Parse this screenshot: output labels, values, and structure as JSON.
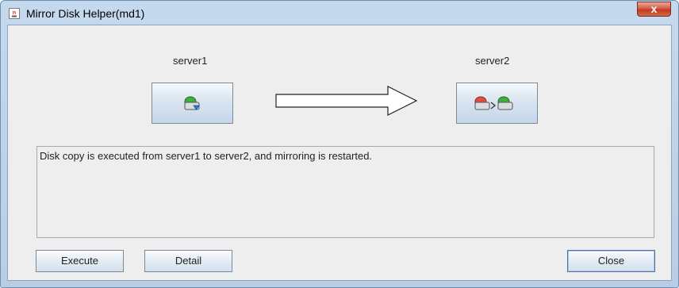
{
  "window": {
    "title": "Mirror Disk Helper(md1)",
    "close_glyph": "x"
  },
  "source": {
    "label": "server1",
    "icon": "disk-copy-source-icon"
  },
  "target": {
    "label": "server2",
    "icon": "disk-to-disk-copy-icon"
  },
  "direction_icon": "right-arrow-icon",
  "message": "Disk copy is executed from server1 to server2, and mirroring is restarted.",
  "buttons": {
    "execute": "Execute",
    "detail": "Detail",
    "close": "Close"
  },
  "colors": {
    "title_bar": "#c5d9ee",
    "panel_background": "#eeeeee",
    "close_button": "#c9472c",
    "disk_green": "#3fae3f",
    "disk_red": "#e0503f"
  }
}
